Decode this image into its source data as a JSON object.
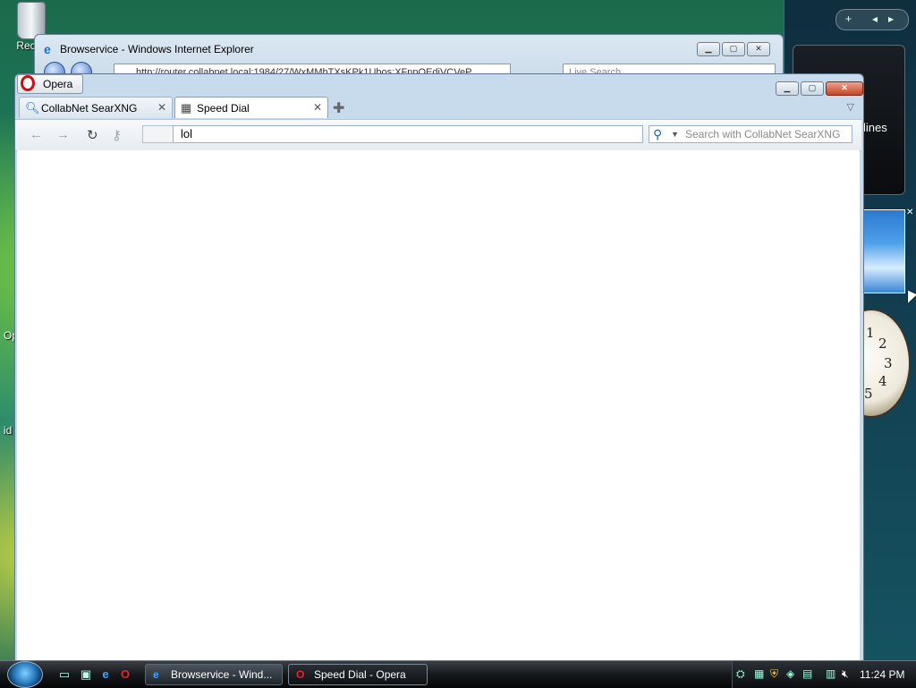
{
  "desktop": {
    "recycle_bin_label": "Recyc",
    "frag_op": "Op",
    "frag_id": "id"
  },
  "sidebar": {
    "add_label": "+",
    "prev_label": "◂",
    "next_label": "▸",
    "headlines_label": "lines",
    "clock_numbers": [
      "1",
      "2",
      "3",
      "4",
      "5"
    ]
  },
  "ie_window": {
    "title": "Browservice - Windows Internet Explorer",
    "address": "http://router.collabnet.local:1984/27/WxMMbTXsKPk1Ubos:XFnpOEdiVCVeP",
    "search_placeholder": "Live Search"
  },
  "opera": {
    "menu_label": "Opera",
    "tabs": [
      {
        "label": "CollabNet SearXNG",
        "icon": "search-icon",
        "active": false
      },
      {
        "label": "Speed Dial",
        "icon": "speed-dial-icon",
        "active": true
      }
    ],
    "address_value": "lol",
    "search_placeholder": "Search with CollabNet SearXNG"
  },
  "taskbar": {
    "tasks": [
      {
        "label": "Browservice - Wind...",
        "icon": "ie-icon"
      },
      {
        "label": "Speed Dial - Opera",
        "icon": "opera-icon"
      }
    ],
    "clock": "11:24 PM"
  },
  "colors": {
    "opera_red": "#cc0f16",
    "ie_blue": "#1a6fd0",
    "window_frame": "#c7dbed"
  }
}
